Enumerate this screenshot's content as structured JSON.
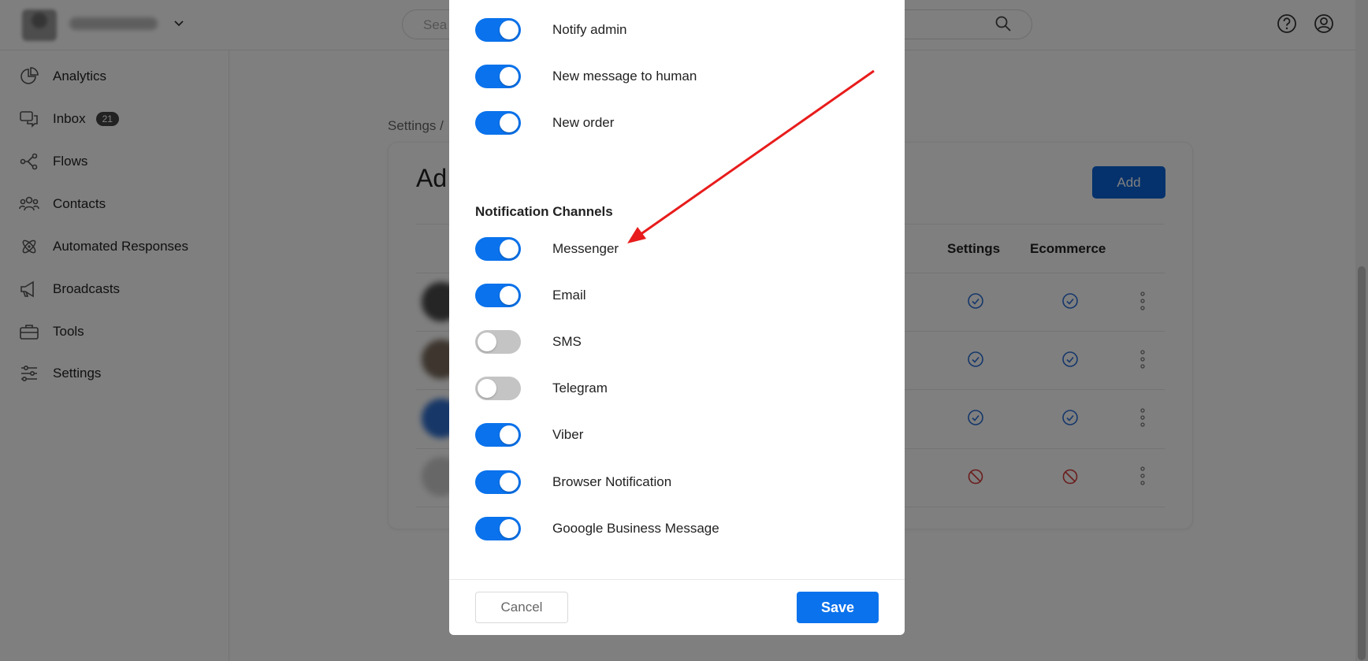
{
  "topbar": {
    "search_placeholder": "Sea"
  },
  "sidebar": {
    "items": [
      {
        "label": "Analytics",
        "icon": "pie-chart-icon"
      },
      {
        "label": "Inbox",
        "icon": "chat-bubbles-icon",
        "badge": "21"
      },
      {
        "label": "Flows",
        "icon": "flow-nodes-icon"
      },
      {
        "label": "Contacts",
        "icon": "contacts-icon"
      },
      {
        "label": "Automated Responses",
        "icon": "atom-icon"
      },
      {
        "label": "Broadcasts",
        "icon": "megaphone-icon"
      },
      {
        "label": "Tools",
        "icon": "toolbox-icon"
      },
      {
        "label": "Settings",
        "icon": "sliders-icon"
      }
    ]
  },
  "main": {
    "breadcrumb": "Settings /",
    "card_title": "Ad",
    "add_label": "Add",
    "columns": [
      "Settings",
      "Ecommerce"
    ],
    "rows": [
      {
        "settings": "check",
        "ecommerce": "check"
      },
      {
        "settings": "check",
        "ecommerce": "check"
      },
      {
        "settings": "check",
        "ecommerce": "check"
      },
      {
        "settings": "blocked",
        "ecommerce": "blocked"
      }
    ]
  },
  "modal": {
    "events": [
      {
        "label": "Notify admin",
        "on": true
      },
      {
        "label": "New message to human",
        "on": true
      },
      {
        "label": "New order",
        "on": true
      }
    ],
    "channels_title": "Notification Channels",
    "channels": [
      {
        "label": "Messenger",
        "on": true
      },
      {
        "label": "Email",
        "on": true
      },
      {
        "label": "SMS",
        "on": false
      },
      {
        "label": "Telegram",
        "on": false
      },
      {
        "label": "Viber",
        "on": true
      },
      {
        "label": "Browser Notification",
        "on": true
      },
      {
        "label": "Gooogle Business Message",
        "on": true
      }
    ],
    "cancel_label": "Cancel",
    "save_label": "Save"
  },
  "colors": {
    "accent": "#0a72ec",
    "toggle_off": "#c4c4c4",
    "status_ok": "#2b6fd6",
    "status_blocked": "#d63a3a",
    "annotation": "#e81c1c"
  }
}
